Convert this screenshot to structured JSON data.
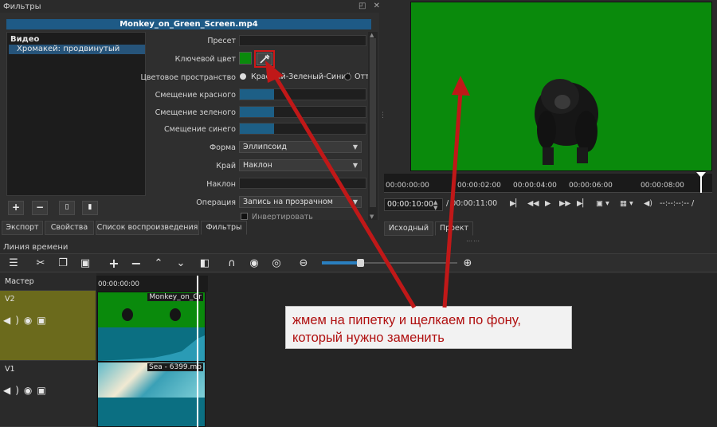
{
  "filters_panel": {
    "title": "Фильтры",
    "float_icons": "◰ ✕",
    "file_name": "Monkey_on_Green_Screen.mp4",
    "filter_list": {
      "category": "Видео",
      "items": [
        {
          "label": "Хромакей: продвинутый",
          "selected": true
        }
      ]
    },
    "params": {
      "preset_label": "Пресет",
      "key_color_label": "Ключевой цвет",
      "key_color": "#0a8a0c",
      "eyedropper_icon": "eyedropper-icon",
      "color_space_label": "Цветовое пространство",
      "color_space_option1": "Красный-Зеленый-Синий",
      "color_space_option2": "Отт",
      "red_shift_label": "Смещение красного",
      "green_shift_label": "Смещение зеленого",
      "blue_shift_label": "Смещение синего",
      "shape_label": "Форма",
      "shape_value": "Эллипсоид",
      "edge_label": "Край",
      "edge_value": "Наклон",
      "slope_label": "Наклон",
      "operation_label": "Операция",
      "operation_value": "Запись на прозрачном",
      "invert_label": "Инвертировать"
    },
    "list_buttons": [
      "+",
      "−",
      "▯",
      "▮"
    ]
  },
  "left_tabs": [
    {
      "label": "Экспорт"
    },
    {
      "label": "Свойства"
    },
    {
      "label": "Список воспроизведения"
    },
    {
      "label": "Фильтры",
      "active": true
    }
  ],
  "player": {
    "ruler_ticks": [
      "00:00:00:00",
      "00:00:02:00",
      "00:00:04:00",
      "00:00:06:00",
      "00:00:08:00"
    ],
    "current_time": "00:00:10:00",
    "duration": "/ 00:00:11:00",
    "end_time": "--:--:--:-- /",
    "tabs": [
      {
        "label": "Исходный"
      },
      {
        "label": "Проект",
        "active": true
      }
    ]
  },
  "timeline": {
    "title": "Линия времени",
    "master_label": "Мастер",
    "ruler_start": "00:00:00:00",
    "tracks": [
      {
        "name": "V2",
        "clip": "Monkey_on_Gr"
      },
      {
        "name": "V1",
        "clip": "Sea - 6399.mp"
      }
    ]
  },
  "annotation": {
    "line1": "жмем на пипетку и щелкаем по фону,",
    "line2": "который нужно заменить",
    "color": "#b01010"
  },
  "colors": {
    "accent": "#1e5a86",
    "green_screen": "#0a8a0c",
    "arrow": "#c01818"
  }
}
